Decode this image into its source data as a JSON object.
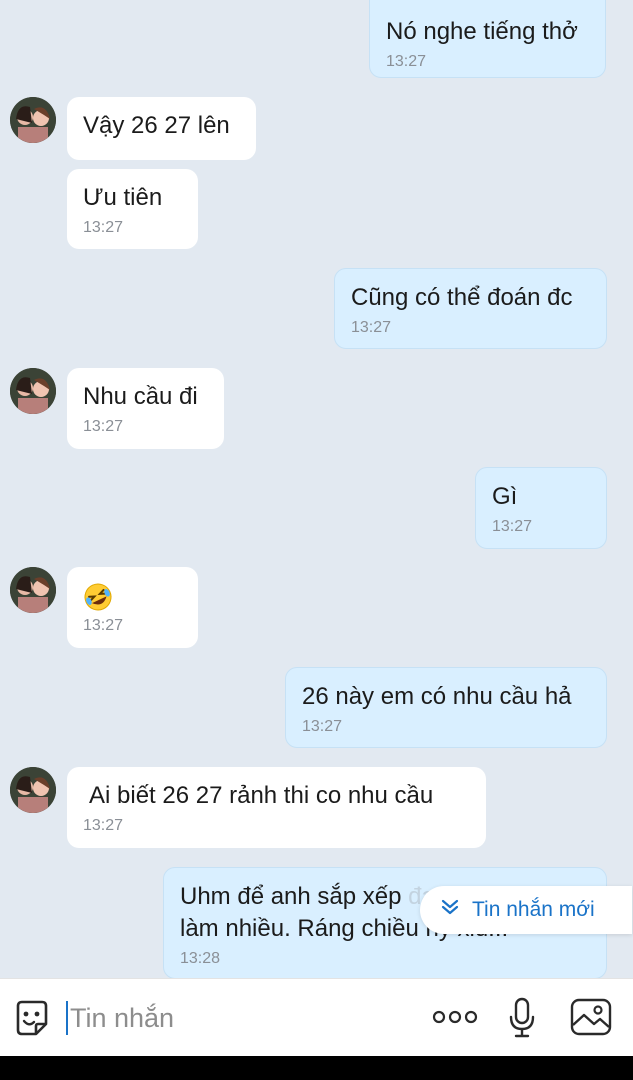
{
  "messages": [
    {
      "dir": "out",
      "text": "Nó nghe tiếng thở",
      "time": "13:27"
    },
    {
      "dir": "in",
      "text": "Vậy 26 27 lên",
      "time": "",
      "avatar": true
    },
    {
      "dir": "in",
      "text": "Ưu tiên",
      "time": "13:27"
    },
    {
      "dir": "out",
      "text": "Cũng có thể đoán đc",
      "time": "13:27"
    },
    {
      "dir": "in",
      "text": "Nhu cầu đi",
      "time": "13:27",
      "avatar": true
    },
    {
      "dir": "out",
      "text": "Gì",
      "time": "13:27"
    },
    {
      "dir": "in",
      "text": "",
      "emoji": "rofl-emoji",
      "time": "13:27",
      "avatar": true
    },
    {
      "dir": "out",
      "text": "26 này em có nhu cầu hả",
      "time": "13:27"
    },
    {
      "dir": "in",
      "text": "Ai biết 26 27 rảnh thi co nhu cầu",
      "time": "13:27",
      "avatar": true
    },
    {
      "dir": "out",
      "text_line1": "Uhm để anh sắp xếp",
      "text_line1_hidden": "đạo này nưa",
      "text_line2": "làm nhiều. Ráng chiều ny xiu...",
      "time": "13:28"
    }
  ],
  "new_message_pill": {
    "label": "Tin nhắn mới",
    "icon": "double-chevron-down-icon"
  },
  "composer": {
    "placeholder": "Tin nhắn",
    "icons": [
      "sticker-icon",
      "more-icon",
      "microphone-icon",
      "image-icon"
    ]
  },
  "colors": {
    "background": "#e2e9f1",
    "incoming_bubble": "#ffffff",
    "outgoing_bubble": "#d9efff",
    "accent": "#1a73c8",
    "timestamp": "#8a8f96"
  }
}
